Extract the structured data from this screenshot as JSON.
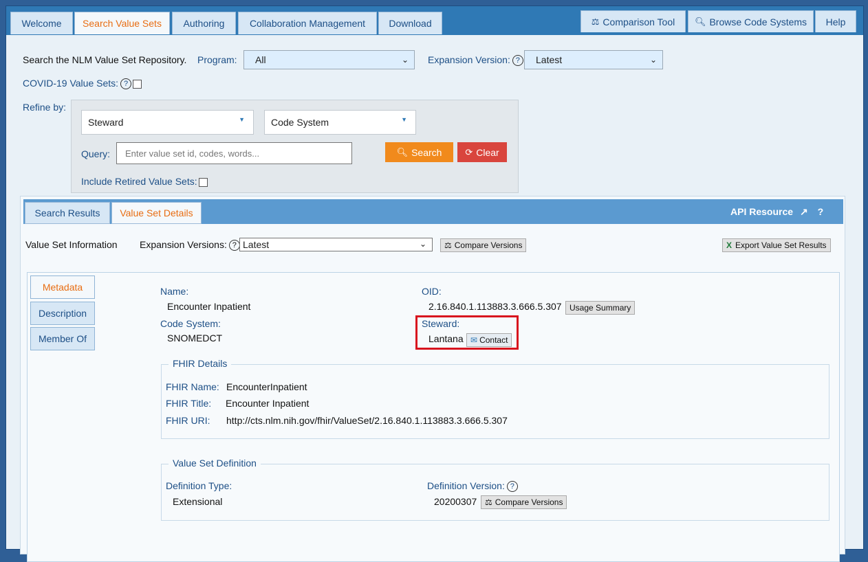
{
  "nav": {
    "tabs": [
      "Welcome",
      "Search Value Sets",
      "Authoring",
      "Collaboration Management",
      "Download"
    ],
    "right": [
      "Comparison Tool",
      "Browse Code Systems",
      "Help"
    ]
  },
  "search": {
    "intro": "Search the NLM Value Set Repository.",
    "program_label": "Program:",
    "program_value": "All",
    "expansion_label": "Expansion Version:",
    "expansion_value": "Latest",
    "covid_label": "COVID-19 Value Sets:",
    "refine_label": "Refine by:",
    "steward_dropdown": "Steward",
    "codesystem_dropdown": "Code System",
    "query_label": "Query:",
    "query_placeholder": "Enter value set id, codes, words...",
    "search_button": "Search",
    "clear_button": "Clear",
    "retired_label": "Include Retired Value Sets:"
  },
  "results": {
    "tabs": [
      "Search Results",
      "Value Set Details"
    ],
    "api_resource": "API Resource",
    "vsi_label": "Value Set Information",
    "exp_label": "Expansion Versions:",
    "exp_value": "Latest",
    "compare_versions": "Compare Versions",
    "export": "Export Value Set Results"
  },
  "details": {
    "side_tabs": [
      "Metadata",
      "Description",
      "Member Of"
    ],
    "name_label": "Name:",
    "name_value": "Encounter Inpatient",
    "code_system_label": "Code System:",
    "code_system_value": "SNOMEDCT",
    "oid_label": "OID:",
    "oid_value": "2.16.840.1.113883.3.666.5.307",
    "usage_summary": "Usage Summary",
    "steward_label": "Steward:",
    "steward_value": "Lantana",
    "contact_button": "Contact",
    "fhir": {
      "title": "FHIR Details",
      "name_label": "FHIR Name:",
      "name_value": "EncounterInpatient",
      "title_label": "FHIR Title:",
      "title_value": "Encounter Inpatient",
      "uri_label": "FHIR URI:",
      "uri_value": "http://cts.nlm.nih.gov/fhir/ValueSet/2.16.840.1.113883.3.666.5.307"
    },
    "definition": {
      "title": "Value Set Definition",
      "type_label": "Definition Type:",
      "type_value": "Extensional",
      "version_label": "Definition Version:",
      "version_value": "20200307",
      "compare_versions": "Compare Versions"
    }
  },
  "colors": {
    "accent": "#e86d12",
    "nav": "#2f79b5",
    "highlight": "#d8141e"
  }
}
